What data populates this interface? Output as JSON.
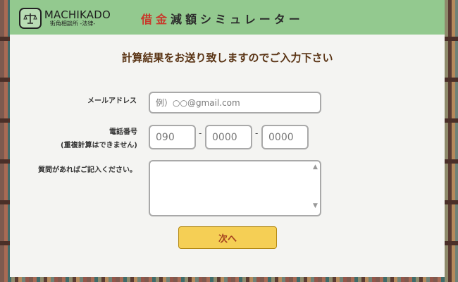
{
  "header": {
    "logo_name": "MACHIKADO",
    "logo_sub": "街角相談所 -法律-",
    "title_red": "借金",
    "title_rest": "減額シミュレーター"
  },
  "form": {
    "heading": "計算結果をお送り致しますのでご入力下さい",
    "email_label": "メールアドレス",
    "email_placeholder": "例）○○@gmail.com",
    "phone_label": "電話番号",
    "phone_note": "(重複計算はできません)",
    "phone_placeholders": [
      "090",
      "0000",
      "0000"
    ],
    "phone_separator": "-",
    "question_label": "質問があればご記入ください。",
    "next_button": "次へ"
  },
  "colors": {
    "header_bg": "#93c98f",
    "accent_red": "#c8392b",
    "button_bg": "#f5cf55",
    "heading_brown": "#5a3415"
  }
}
